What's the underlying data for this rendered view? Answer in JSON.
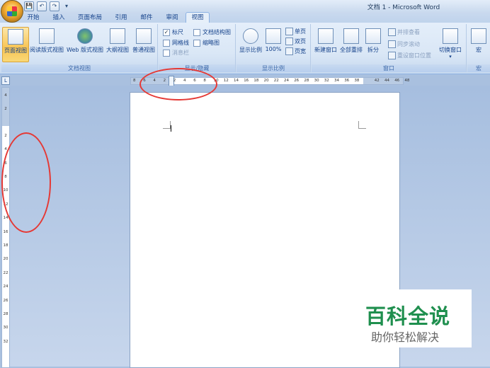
{
  "window_title": "文档 1 - Microsoft Word",
  "qat": {
    "save": "💾",
    "undo": "↶",
    "redo": "↷",
    "more": "▾"
  },
  "tabs": [
    "开始",
    "插入",
    "页面布局",
    "引用",
    "邮件",
    "审阅",
    "视图"
  ],
  "active_tab": "视图",
  "groups": {
    "doc_views": {
      "label": "文档视图",
      "buttons": [
        "页面视图",
        "阅读版式视图",
        "Web 版式视图",
        "大纲视图",
        "普通视图"
      ]
    },
    "show_hide": {
      "label": "显示/隐藏",
      "options": [
        {
          "label": "标尺",
          "checked": true
        },
        {
          "label": "网格线",
          "checked": false
        },
        {
          "label": "消息栏",
          "checked": false,
          "disabled": true
        },
        {
          "label": "文档结构图",
          "checked": false
        },
        {
          "label": "缩略图",
          "checked": false
        }
      ]
    },
    "zoom": {
      "label": "显示比例",
      "zoom_btn": "显示比例",
      "pct_btn": "100%",
      "single": "单页",
      "double": "双页",
      "width": "页宽"
    },
    "window": {
      "label": "窗口",
      "new_window": "新建窗口",
      "arrange_all": "全部重排",
      "split": "拆分",
      "side_by_side": "并排查看",
      "sync_scroll": "同步滚动",
      "reset_pos": "重设窗口位置",
      "switch": "切换窗口"
    },
    "macro": {
      "label": "宏",
      "btn": "宏"
    }
  },
  "hruler_ticks": [
    "8",
    "6",
    "4",
    "2",
    "2",
    "4",
    "6",
    "8",
    "10",
    "12",
    "14",
    "16",
    "18",
    "20",
    "22",
    "24",
    "26",
    "28",
    "30",
    "32",
    "34",
    "36",
    "38",
    "42",
    "44",
    "46",
    "48"
  ],
  "vruler_ticks": [
    "4",
    "2",
    "2",
    "4",
    "6",
    "8",
    "10",
    "12",
    "14",
    "16",
    "18",
    "20",
    "22",
    "24",
    "26",
    "28",
    "30",
    "32"
  ],
  "watermark": {
    "title": "百科全说",
    "subtitle": "助你轻松解决"
  },
  "colors": {
    "annotation": "#e53935",
    "watermark_green": "#1f8f4e"
  }
}
